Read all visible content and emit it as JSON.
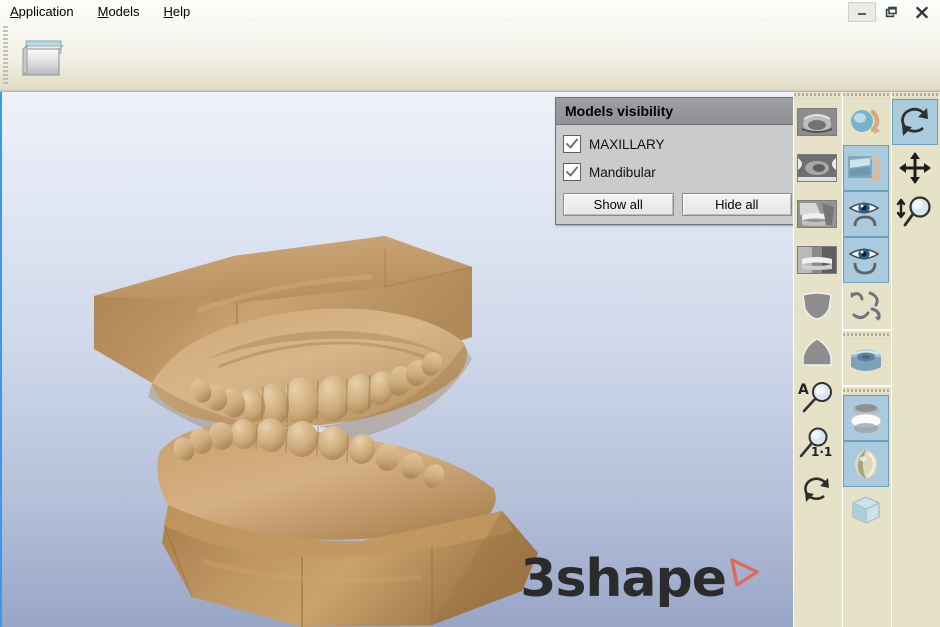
{
  "window": {
    "controls": [
      {
        "name": "minimize",
        "glyph": "minimize-icon"
      },
      {
        "name": "restore",
        "glyph": "restore-icon"
      },
      {
        "name": "close",
        "glyph": "close-icon"
      }
    ]
  },
  "menubar": {
    "items": [
      {
        "accel": "A",
        "rest": "pplication",
        "full": "Application"
      },
      {
        "accel": "M",
        "rest": "odels",
        "full": "Models"
      },
      {
        "accel": "H",
        "rest": "elp",
        "full": "Help"
      }
    ]
  },
  "toolstrip": {
    "open_button": {
      "icon": "open-folder-icon",
      "label": ""
    }
  },
  "viewport": {
    "logo_text": "3shape",
    "logo_triangle_color": "#e06a5a",
    "background_top": "#eef2f9",
    "background_bottom": "#98a5c6",
    "model_color_light": "#d6b183",
    "model_color_mid": "#c49a66",
    "model_color_dark": "#a87f4e"
  },
  "models_visibility": {
    "title": "Models visibility",
    "items": [
      {
        "label": "MAXILLARY",
        "checked": true
      },
      {
        "label": "Mandibular",
        "checked": true
      }
    ],
    "buttons": [
      {
        "label": "Show all"
      },
      {
        "label": "Hide all"
      }
    ]
  },
  "toolbars": {
    "views": {
      "name": "view-presets-toolbar",
      "groups": [
        {
          "buttons": [
            {
              "icon": "view-occlusal-upper-icon",
              "selected": false
            },
            {
              "icon": "view-occlusal-lower-icon",
              "selected": false
            },
            {
              "icon": "view-right-buccal-icon",
              "selected": false
            },
            {
              "icon": "view-left-buccal-icon",
              "selected": false
            },
            {
              "icon": "view-maxillary-arch-icon",
              "selected": false
            },
            {
              "icon": "view-mandibular-arch-icon",
              "selected": false
            },
            {
              "icon": "zoom-fit-all-icon",
              "selected": false
            },
            {
              "icon": "zoom-one-to-one-icon",
              "selected": false
            },
            {
              "icon": "reset-view-icon",
              "selected": false
            }
          ]
        }
      ]
    },
    "tools": {
      "name": "model-tools-toolbar",
      "groups": [
        {
          "buttons": [
            {
              "icon": "rotate-model-icon",
              "selected": false
            },
            {
              "icon": "align-model-icon",
              "selected": true
            },
            {
              "icon": "show-upper-arch-icon",
              "selected": true
            },
            {
              "icon": "show-lower-arch-icon",
              "selected": true
            },
            {
              "icon": "arch-curve-icon",
              "selected": false
            }
          ]
        },
        {
          "buttons": [
            {
              "icon": "model-base-icon",
              "selected": false
            }
          ]
        },
        {
          "buttons": [
            {
              "icon": "articulator-icon",
              "selected": true
            },
            {
              "icon": "plaster-texture-icon",
              "selected": true
            },
            {
              "icon": "bounding-box-icon",
              "selected": false
            }
          ]
        }
      ]
    },
    "nav": {
      "name": "navigation-toolbar",
      "groups": [
        {
          "buttons": [
            {
              "icon": "rotate-tool-icon",
              "selected": true
            },
            {
              "icon": "pan-tool-icon",
              "selected": false
            },
            {
              "icon": "zoom-tool-icon",
              "selected": false
            }
          ]
        }
      ]
    }
  }
}
